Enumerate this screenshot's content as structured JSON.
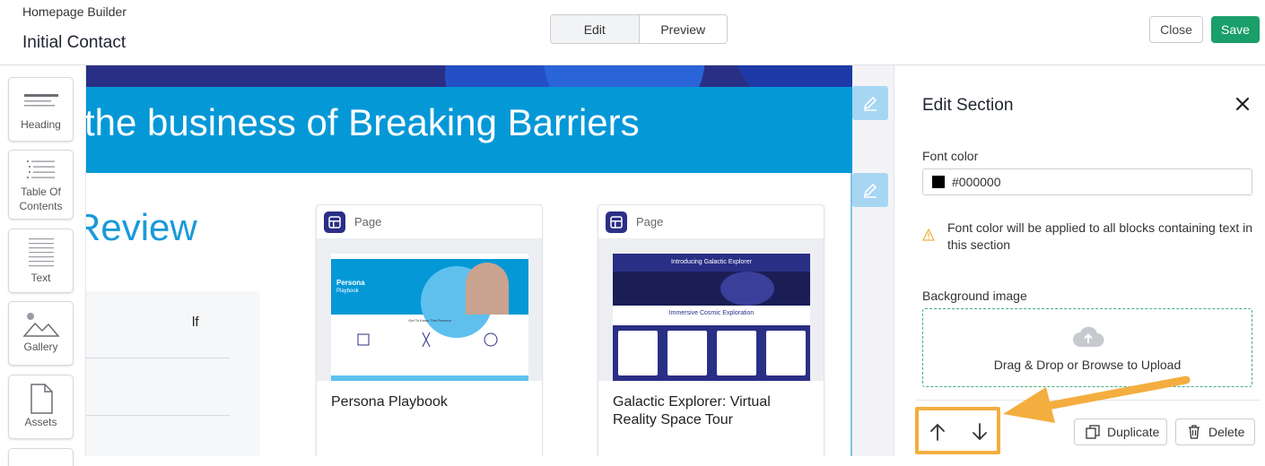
{
  "header": {
    "app_name": "Homepage Builder",
    "doc_title": "Initial Contact",
    "tabs": [
      "Edit",
      "Preview"
    ],
    "close_label": "Close",
    "save_label": "Save"
  },
  "toolbox": [
    {
      "label": "Heading",
      "icon": "heading-icon"
    },
    {
      "label": "Table Of Contents",
      "icon": "table-of-contents-icon"
    },
    {
      "label": "Text",
      "icon": "text-icon"
    },
    {
      "label": "Gallery",
      "icon": "gallery-icon"
    },
    {
      "label": "Assets",
      "icon": "assets-icon"
    }
  ],
  "canvas": {
    "hero_title": "the business of Breaking Barriers",
    "review_heading": "Review",
    "side_text": "lf",
    "cards": [
      {
        "type": "Page",
        "title": "Persona Playbook",
        "thumb": {
          "banner_title": "Persona",
          "banner_sub": "Playbook",
          "section": "Get To Know This Persona"
        }
      },
      {
        "type": "Page",
        "title": "Galactic Explorer: Virtual Reality Space Tour",
        "thumb": {
          "banner_title": "Introducing Galactic Explorer",
          "section": "Immersive Cosmic Exploration"
        }
      }
    ]
  },
  "panel": {
    "title": "Edit Section",
    "font_color_label": "Font color",
    "font_color_value": "#000000",
    "font_color_note": "Font color will be applied to all blocks containing text in this section",
    "bg_image_label": "Background image",
    "upload_text": "Drag & Drop or Browse to Upload",
    "duplicate_label": "Duplicate",
    "delete_label": "Delete"
  },
  "colors": {
    "accent_green": "#1a9e6a",
    "hero_blue": "#0598d7",
    "navy": "#2a2f86",
    "highlight_orange": "#f3ae3f"
  }
}
